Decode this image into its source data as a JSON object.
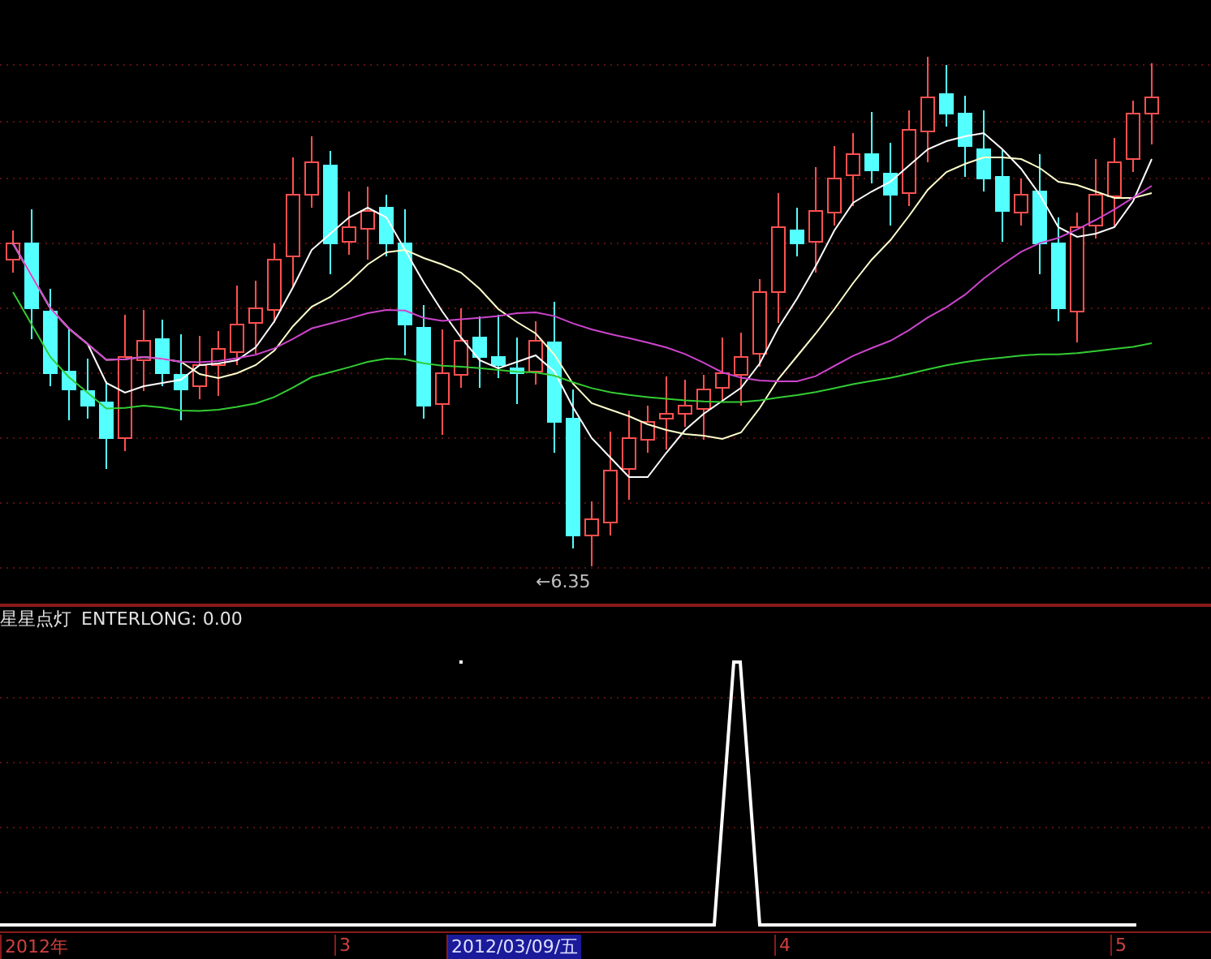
{
  "main_chart": {
    "low_marker": "←6.35"
  },
  "indicator": {
    "name": "星星点灯",
    "reading": "ENTERLONG: 0.00"
  },
  "time_axis": [
    {
      "label": "2012年",
      "selected": false
    },
    {
      "label": "3",
      "selected": false
    },
    {
      "label": "2012/03/09/五",
      "selected": true
    },
    {
      "label": "4",
      "selected": false
    },
    {
      "label": "5",
      "selected": false
    }
  ]
}
